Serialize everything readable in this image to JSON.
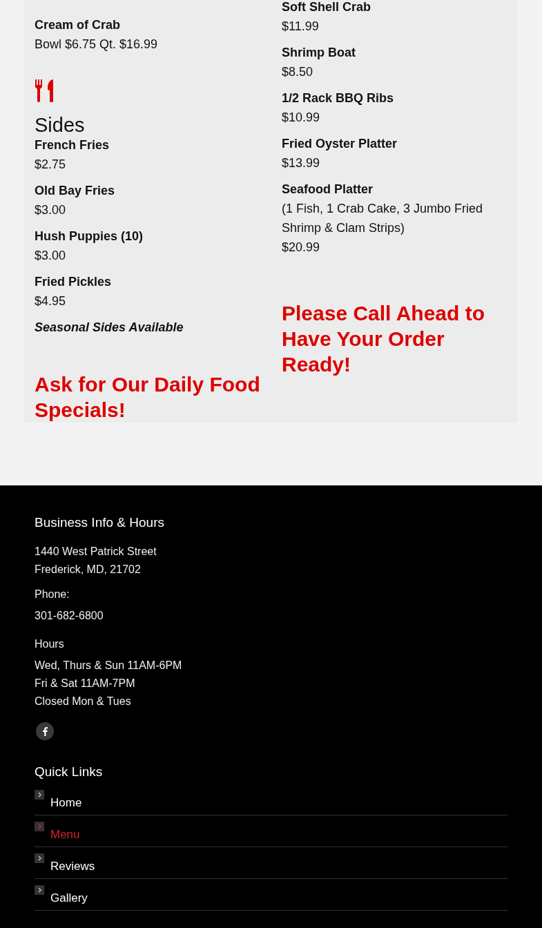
{
  "menu": {
    "left": {
      "items": [
        {
          "name": "Cream of Crab",
          "price": "Bowl $6.75 Qt. $16.99"
        }
      ],
      "section": {
        "title": "Sides",
        "items": [
          {
            "name": "French Fries",
            "price": "$2.75"
          },
          {
            "name": "Old Bay Fries",
            "price": "$3.00"
          },
          {
            "name": "Hush Puppies (10)",
            "price": "$3.00"
          },
          {
            "name": "Fried Pickles",
            "price": "$4.95"
          }
        ],
        "note": "Seasonal Sides Available"
      },
      "callout": "Ask for Our Daily Food Specials!"
    },
    "right": {
      "items": [
        {
          "name": "Soft Shell Crab",
          "price": "$11.99"
        },
        {
          "name": "Shrimp Boat",
          "price": "$8.50"
        },
        {
          "name": "1/2 Rack BBQ Ribs",
          "price": "$10.99"
        },
        {
          "name": "Fried Oyster Platter",
          "price": "$13.99"
        },
        {
          "name": "Seafood Platter",
          "detail": "(1 Fish, 1 Crab Cake, 3 Jumbo Fried Shrimp & Clam Strips)",
          "price": "$20.99"
        }
      ],
      "callout": "Please Call Ahead to Have Your Order Ready!"
    }
  },
  "footer": {
    "business": {
      "title": "Business Info & Hours",
      "address": [
        "1440 West Patrick Street",
        "Frederick, MD, 21702"
      ],
      "phone_label": "Phone:",
      "phone": "301-682-6800",
      "hours_label": "Hours",
      "hours": [
        "Wed, Thurs & Sun 11AM-6PM",
        "Fri & Sat 11AM-7PM",
        "Closed Mon & Tues"
      ]
    },
    "quick_links": {
      "title": "Quick Links",
      "links": [
        {
          "label": "Home",
          "selected": false
        },
        {
          "label": "Menu",
          "selected": true
        },
        {
          "label": "Reviews",
          "selected": false
        },
        {
          "label": "Gallery",
          "selected": false
        }
      ]
    }
  }
}
